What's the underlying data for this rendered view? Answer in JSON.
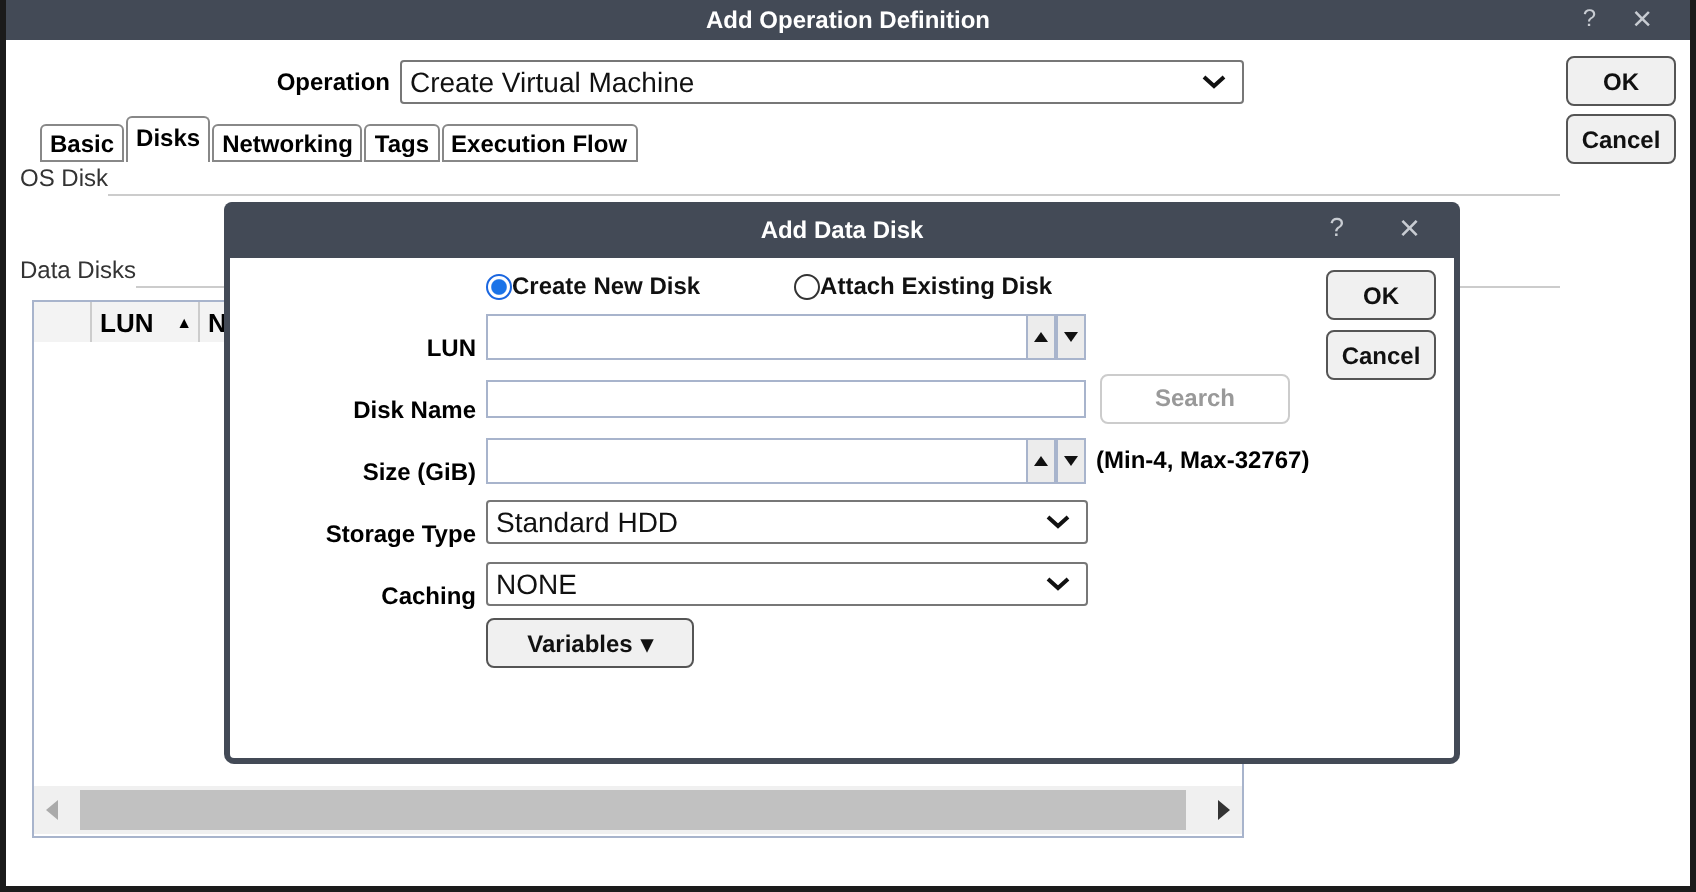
{
  "window": {
    "title": "Add Operation Definition",
    "help": "?",
    "close": "×"
  },
  "operation": {
    "label": "Operation",
    "value": "Create Virtual Machine"
  },
  "buttons": [
    "OK",
    "Cancel"
  ],
  "tabs": [
    {
      "label": "Basic",
      "selected": false
    },
    {
      "label": "Disks",
      "selected": true
    },
    {
      "label": "Networking",
      "selected": false
    },
    {
      "label": "Tags",
      "selected": false
    },
    {
      "label": "Execution Flow",
      "selected": false
    }
  ],
  "sections": [
    "OS Disk",
    "Data Disks"
  ],
  "grid": {
    "columns": [
      {
        "label": "LUN",
        "sort_mark": "▲"
      },
      {
        "label": "N"
      }
    ]
  },
  "dialog": {
    "title": "Add Data Disk",
    "help": "?",
    "close": "×",
    "radios": [
      {
        "label": "Create New Disk",
        "selected": true
      },
      {
        "label": "Attach Existing Disk",
        "selected": false
      }
    ],
    "fields": [
      {
        "kind": "spin",
        "label": "LUN"
      },
      {
        "kind": "text",
        "label": "Disk Name",
        "button": {
          "label": "Search",
          "disabled": true
        }
      },
      {
        "kind": "spin",
        "label": "Size (GiB)",
        "note": "(Min-4, Max-32767)"
      },
      {
        "kind": "select",
        "label": "Storage Type",
        "value": "Standard HDD"
      },
      {
        "kind": "select",
        "label": "Caching",
        "value": "NONE"
      }
    ],
    "menu_button": {
      "label": "Variables",
      "caret": "▾"
    },
    "buttons": [
      "OK",
      "Cancel"
    ]
  }
}
